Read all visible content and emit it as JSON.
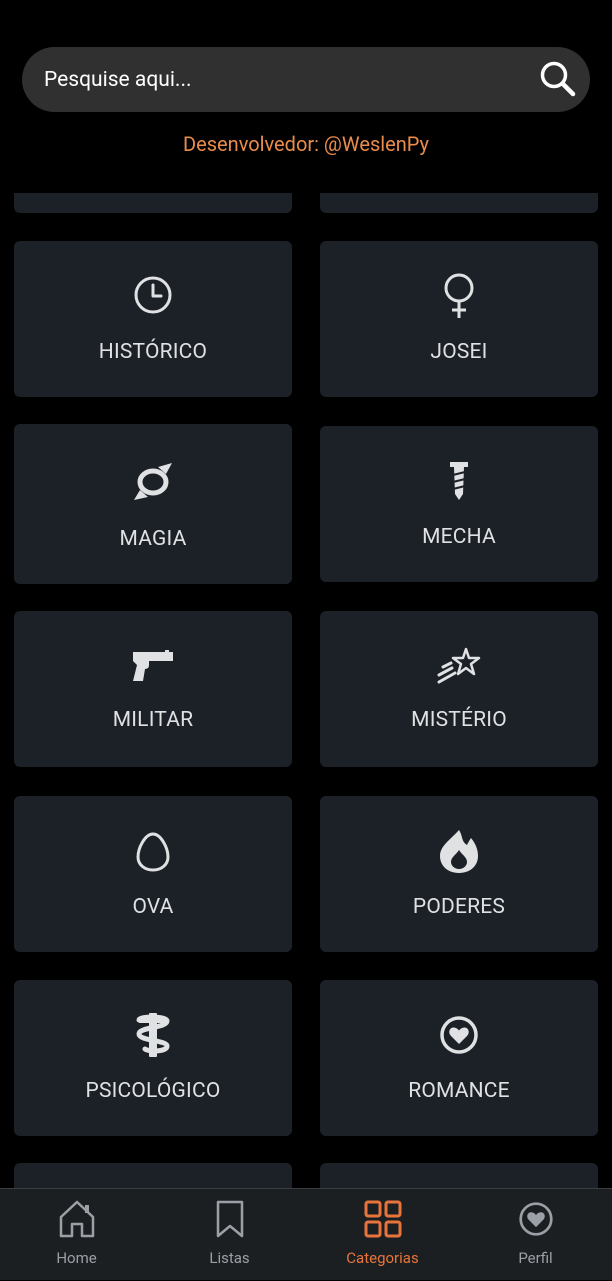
{
  "search": {
    "placeholder": "Pesquise aqui...",
    "icon": "search-icon"
  },
  "developer_credit": "Desenvolvedor: @WeslenPy",
  "categories": [
    {
      "label": "HISTÓRICO",
      "icon": "clock-icon"
    },
    {
      "label": "JOSEI",
      "icon": "female-symbol-icon"
    },
    {
      "label": "MAGIA",
      "icon": "magic-swirl-icon"
    },
    {
      "label": "MECHA",
      "icon": "screw-icon"
    },
    {
      "label": "MILITAR",
      "icon": "pistol-icon"
    },
    {
      "label": "MISTÉRIO",
      "icon": "shooting-star-icon"
    },
    {
      "label": "OVA",
      "icon": "egg-icon"
    },
    {
      "label": "PODERES",
      "icon": "fire-icon"
    },
    {
      "label": "PSICOLÓGICO",
      "icon": "staff-of-hermes-icon"
    },
    {
      "label": "ROMANCE",
      "icon": "heart-circle-icon"
    }
  ],
  "bottom_nav": {
    "items": [
      {
        "label": "Home",
        "icon": "home-icon",
        "active": false
      },
      {
        "label": "Listas",
        "icon": "bookmark-icon",
        "active": false
      },
      {
        "label": "Categorias",
        "icon": "grid-icon",
        "active": true
      },
      {
        "label": "Perfil",
        "icon": "heart-circle-icon",
        "active": false
      }
    ]
  },
  "colors": {
    "background": "#000000",
    "card": "#1c2127",
    "search_bar": "#303030",
    "accent": "#e8743b",
    "developer_text": "#e98c4c",
    "label_text": "#dfe1e3",
    "nav_inactive": "#9aa0a6"
  }
}
